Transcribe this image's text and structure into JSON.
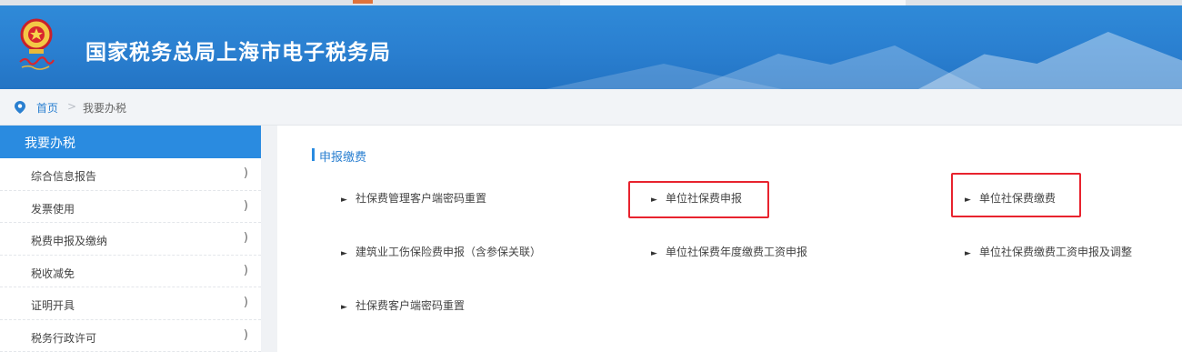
{
  "header": {
    "site_title": "国家税务总局上海市电子税务局",
    "colors": {
      "primary": "#2a7fd0",
      "highlight": "#e8232e"
    }
  },
  "breadcrumb": {
    "home": "首页",
    "separator": ">",
    "current": "我要办税"
  },
  "sidebar": {
    "title": "我要办税",
    "items": [
      {
        "label": "综合信息报告",
        "chevron": ")"
      },
      {
        "label": "发票使用",
        "chevron": ")"
      },
      {
        "label": "税费申报及缴纳",
        "chevron": ")"
      },
      {
        "label": "税收减免",
        "chevron": ")"
      },
      {
        "label": "证明开具",
        "chevron": ")"
      },
      {
        "label": "税务行政许可",
        "chevron": ")"
      }
    ]
  },
  "main": {
    "section_title": "申报缴费",
    "links": [
      {
        "label": "社保费管理客户端密码重置",
        "highlighted": false
      },
      {
        "label": "单位社保费申报",
        "highlighted": true
      },
      {
        "label": "单位社保费缴费",
        "highlighted": true
      },
      {
        "label": "建筑业工伤保险费申报（含参保关联）",
        "highlighted": false
      },
      {
        "label": "单位社保费年度缴费工资申报",
        "highlighted": false
      },
      {
        "label": "单位社保费缴费工资申报及调整",
        "highlighted": false
      },
      {
        "label": "社保费客户端密码重置",
        "highlighted": false
      }
    ]
  }
}
